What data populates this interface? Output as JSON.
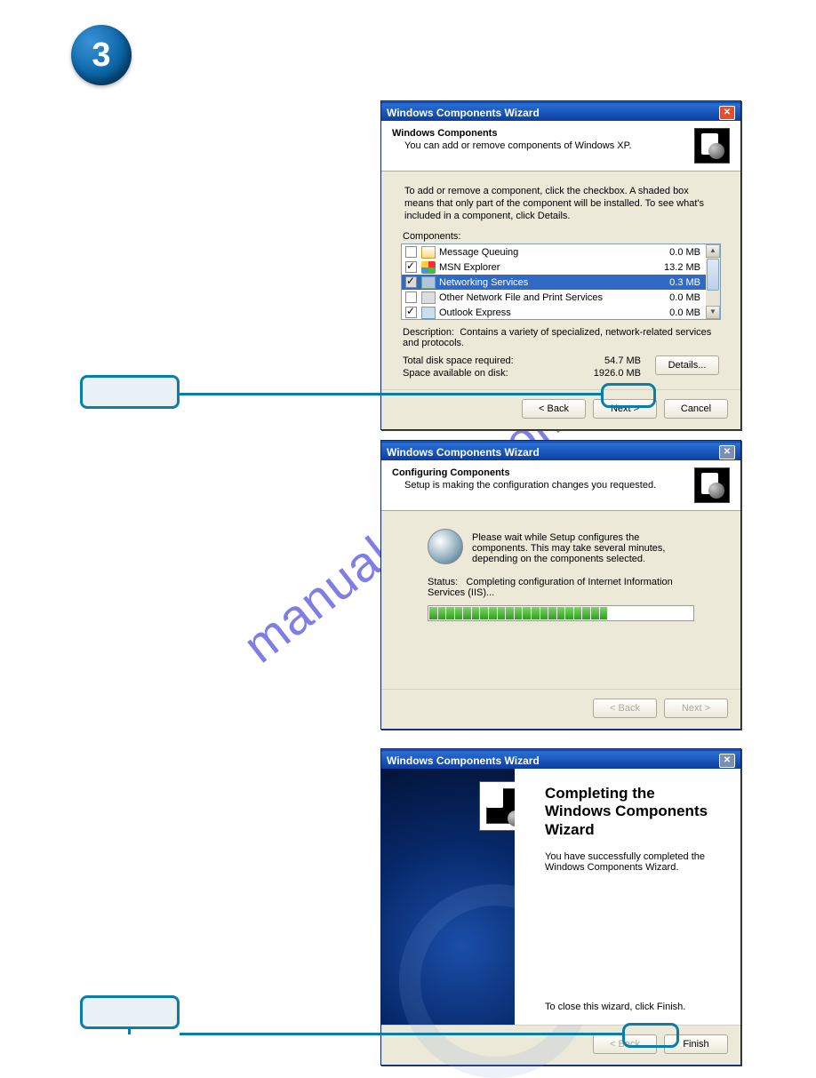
{
  "step_number": "3",
  "watermark": "manualshive.com",
  "dialog1": {
    "title": "Windows Components Wizard",
    "header_title": "Windows Components",
    "header_sub": "You can add or remove components of Windows XP.",
    "instructions": "To add or remove a component, click the checkbox. A shaded box means that only part of the component will be installed. To see what's included in a component, click Details.",
    "components_label": "Components:",
    "rows": [
      {
        "checked": false,
        "shaded": false,
        "icon": "ico-env",
        "label": "Message Queuing",
        "size": "0.0 MB"
      },
      {
        "checked": true,
        "shaded": false,
        "icon": "ico-msn",
        "label": "MSN Explorer",
        "size": "13.2 MB"
      },
      {
        "checked": true,
        "shaded": true,
        "icon": "ico-net",
        "label": "Networking Services",
        "size": "0.3 MB",
        "selected": true
      },
      {
        "checked": false,
        "shaded": false,
        "icon": "ico-srv",
        "label": "Other Network File and Print Services",
        "size": "0.0 MB"
      },
      {
        "checked": true,
        "shaded": false,
        "icon": "ico-oe",
        "label": "Outlook Express",
        "size": "0.0 MB"
      }
    ],
    "description_label": "Description:",
    "description": "Contains a variety of specialized, network-related services and protocols.",
    "disk_req_label": "Total disk space required:",
    "disk_req_value": "54.7 MB",
    "disk_avail_label": "Space available on disk:",
    "disk_avail_value": "1926.0 MB",
    "details_btn": "Details...",
    "back_btn": "< Back",
    "next_btn": "Next >",
    "cancel_btn": "Cancel"
  },
  "dialog2": {
    "title": "Windows Components Wizard",
    "header_title": "Configuring Components",
    "header_sub": "Setup is making the configuration changes you requested.",
    "wait_text": "Please wait while Setup configures the components. This may take several minutes, depending on the components selected.",
    "status_label": "Status:",
    "status_text": "Completing configuration of Internet Information Services (IIS)...",
    "progress_filled": 21,
    "progress_total": 31,
    "back_btn": "< Back",
    "next_btn": "Next >"
  },
  "dialog3": {
    "title": "Windows Components Wizard",
    "finish_title": "Completing the Windows Components Wizard",
    "finish_msg": "You have successfully completed the Windows Components Wizard.",
    "close_hint": "To close this wizard, click Finish.",
    "back_btn": "< Back",
    "finish_btn": "Finish"
  }
}
